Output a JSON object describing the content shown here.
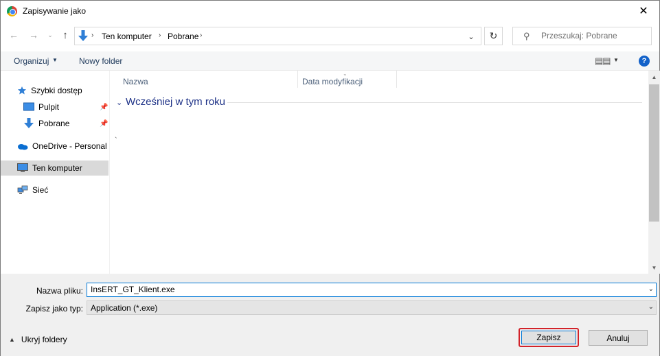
{
  "window": {
    "title": "Zapisywanie jako",
    "close_glyph": "✕"
  },
  "nav": {
    "back_glyph": "←",
    "forward_glyph": "→",
    "recent_glyph": "⌄",
    "up_glyph": "↑",
    "breadcrumb": [
      "Ten komputer",
      "Pobrane"
    ],
    "chevron_glyph": "›",
    "dropdown_glyph": "⌄",
    "refresh_glyph": "↻",
    "search_placeholder": "Przeszukaj: Pobrane"
  },
  "toolbar": {
    "organize_label": "Organizuj",
    "new_folder_label": "Nowy folder",
    "arrow_glyph": "▼",
    "view_glyph": "▤▤",
    "help_glyph": "?"
  },
  "sidebar": {
    "items": [
      {
        "label": "Szybki dostęp",
        "icon": "star-icon"
      },
      {
        "label": "Pulpit",
        "icon": "desktop-icon",
        "pinned": true
      },
      {
        "label": "Pobrane",
        "icon": "download-icon",
        "pinned": true
      },
      {
        "label": "OneDrive - Personal",
        "icon": "cloud-icon"
      },
      {
        "label": "Ten komputer",
        "icon": "computer-icon",
        "selected": true
      },
      {
        "label": "Sieć",
        "icon": "network-icon"
      }
    ],
    "pin_glyph": "📌"
  },
  "files": {
    "columns": [
      "Nazwa",
      "Data modyfikacji"
    ],
    "sort_glyph": "⌄",
    "group_chev_glyph": "⌄",
    "group_title": "Wcześniej w tym roku",
    "stray_mark": "`"
  },
  "scrollbar": {
    "up_glyph": "▲",
    "down_glyph": "▼"
  },
  "bottom": {
    "file_name_label": "Nazwa pliku:",
    "file_name_value": "InsERT_GT_Klient.exe",
    "file_type_label": "Zapisz jako typ:",
    "file_type_value": "Application (*.exe)",
    "combo_glyph": "⌄",
    "hide_folders_label": "Ukryj foldery",
    "hide_chev_glyph": "▲",
    "save_label": "Zapisz",
    "cancel_label": "Anuluj"
  },
  "colors": {
    "accent": "#0078d7",
    "highlight_border": "#d2232a",
    "group_title": "#1e3287"
  }
}
